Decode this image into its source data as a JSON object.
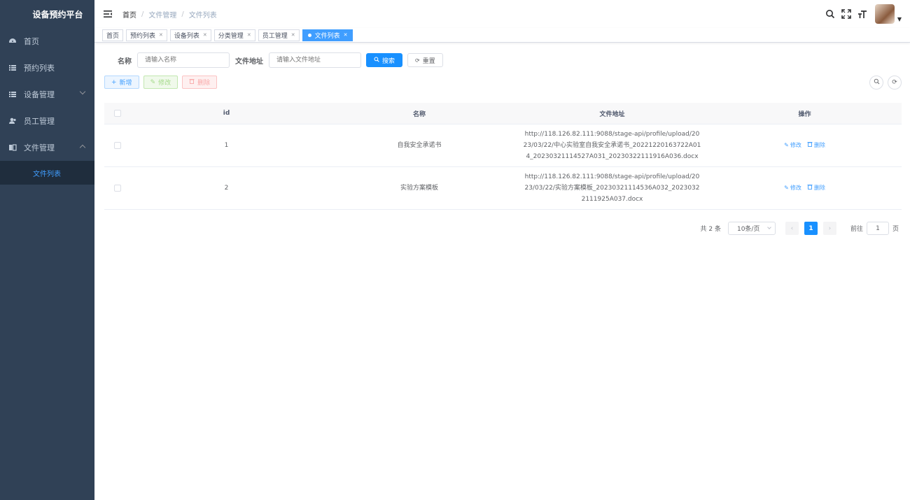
{
  "sidebar": {
    "logo": "设备预约平台",
    "items": [
      {
        "label": "首页",
        "icon": "dashboard-icon"
      },
      {
        "label": "预约列表",
        "icon": "list-icon"
      },
      {
        "label": "设备管理",
        "icon": "list-icon",
        "expandable": true,
        "expanded": false
      },
      {
        "label": "员工管理",
        "icon": "user-icon"
      },
      {
        "label": "文件管理",
        "icon": "book-icon",
        "expandable": true,
        "expanded": true
      }
    ],
    "submenu": {
      "label": "文件列表",
      "active": true
    }
  },
  "navbar": {
    "breadcrumb": [
      "首页",
      "文件管理",
      "文件列表"
    ],
    "separator": "/"
  },
  "tags": [
    {
      "label": "首页",
      "closable": false
    },
    {
      "label": "预约列表",
      "closable": true
    },
    {
      "label": "设备列表",
      "closable": true
    },
    {
      "label": "分类管理",
      "closable": true
    },
    {
      "label": "员工管理",
      "closable": true
    },
    {
      "label": "文件列表",
      "closable": true,
      "active": true
    }
  ],
  "search": {
    "name_label": "名称",
    "name_placeholder": "请输入名称",
    "addr_label": "文件地址",
    "addr_placeholder": "请输入文件地址",
    "search_btn": "搜索",
    "reset_btn": "重置"
  },
  "toolbar": {
    "add": "新增",
    "edit": "修改",
    "delete": "删除"
  },
  "table": {
    "columns": [
      "id",
      "名称",
      "文件地址",
      "操作"
    ],
    "rows": [
      {
        "id": "1",
        "name": "自我安全承诺书",
        "addr": "http://118.126.82.111:9088/stage-api/profile/upload/2023/03/22/中心实验室自我安全承诺书_20221220163722A014_20230321114527A031_20230322111916A036.docx",
        "edit": "修改",
        "delete": "删除"
      },
      {
        "id": "2",
        "name": "实验方案模板",
        "addr": "http://118.126.82.111:9088/stage-api/profile/upload/2023/03/22/实验方案模板_20230321114536A032_20230322111925A037.docx",
        "edit": "修改",
        "delete": "删除"
      }
    ]
  },
  "pagination": {
    "total": "共 2 条",
    "page_size": "10条/页",
    "current_page": "1",
    "goto_label": "前往",
    "goto_value": "1",
    "page_suffix": "页"
  },
  "colors": {
    "sidebar_bg": "#304156",
    "submenu_bg": "#1f2d3d",
    "primary": "#1890ff",
    "accent": "#409eff"
  }
}
